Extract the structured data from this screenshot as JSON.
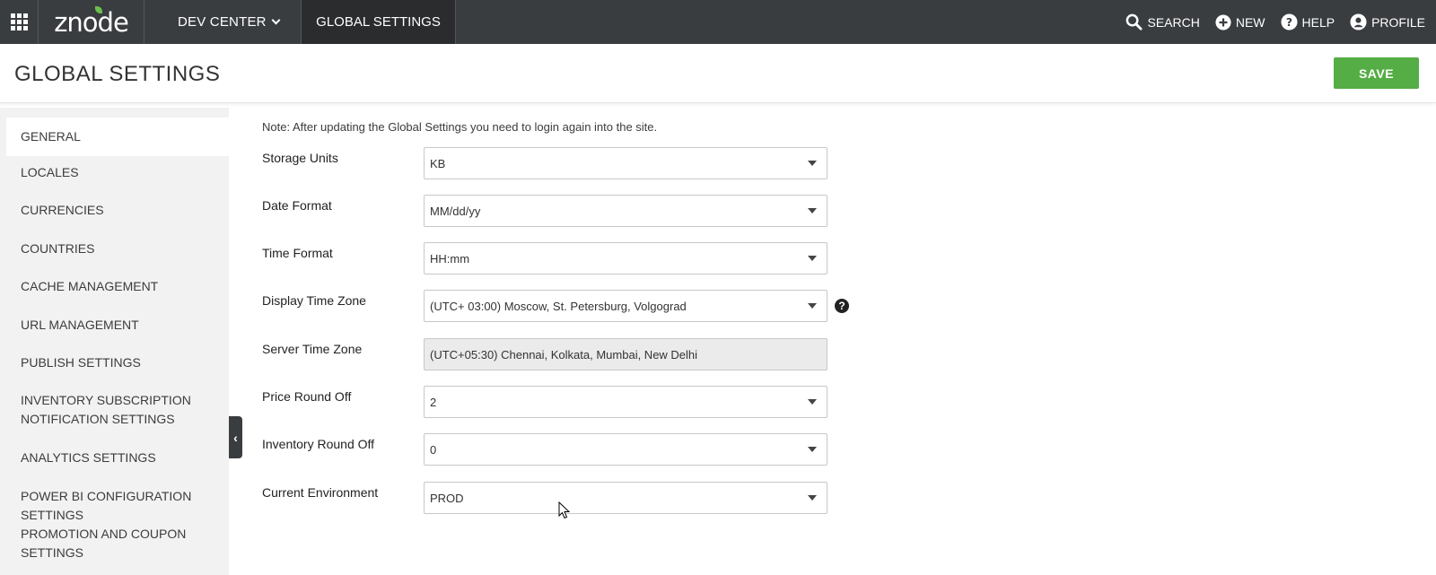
{
  "topbar": {
    "logo": "znode",
    "dev_center": "DEV CENTER",
    "active_tab": "GLOBAL SETTINGS",
    "search": "SEARCH",
    "new": "NEW",
    "help": "HELP",
    "profile": "PROFILE"
  },
  "header": {
    "title": "GLOBAL SETTINGS",
    "save": "SAVE"
  },
  "sidebar": {
    "items": [
      {
        "label": "GENERAL"
      },
      {
        "label": "LOCALES"
      },
      {
        "label": "CURRENCIES"
      },
      {
        "label": "COUNTRIES"
      },
      {
        "label": "CACHE MANAGEMENT"
      },
      {
        "label": "URL MANAGEMENT"
      },
      {
        "label": "PUBLISH SETTINGS"
      },
      {
        "label": "INVENTORY SUBSCRIPTION",
        "label2": "NOTIFICATION SETTINGS"
      },
      {
        "label": "ANALYTICS SETTINGS"
      },
      {
        "label": "POWER BI CONFIGURATION SETTINGS"
      },
      {
        "label": "PROMOTION AND COUPON SETTINGS"
      }
    ]
  },
  "form": {
    "note": "Note: After updating the Global Settings you need to login again into the site.",
    "fields": [
      {
        "label": "Storage Units",
        "value": "KB"
      },
      {
        "label": "Date Format",
        "value": "MM/dd/yy"
      },
      {
        "label": "Time Format",
        "value": "HH:mm"
      },
      {
        "label": "Display Time Zone",
        "value": "(UTC+ 03:00) Moscow, St. Petersburg, Volgograd"
      },
      {
        "label": "Server Time Zone",
        "value": "(UTC+05:30) Chennai, Kolkata, Mumbai, New Delhi"
      },
      {
        "label": "Price Round Off",
        "value": "2"
      },
      {
        "label": "Inventory Round Off",
        "value": "0"
      },
      {
        "label": "Current Environment",
        "value": "PROD"
      }
    ]
  }
}
